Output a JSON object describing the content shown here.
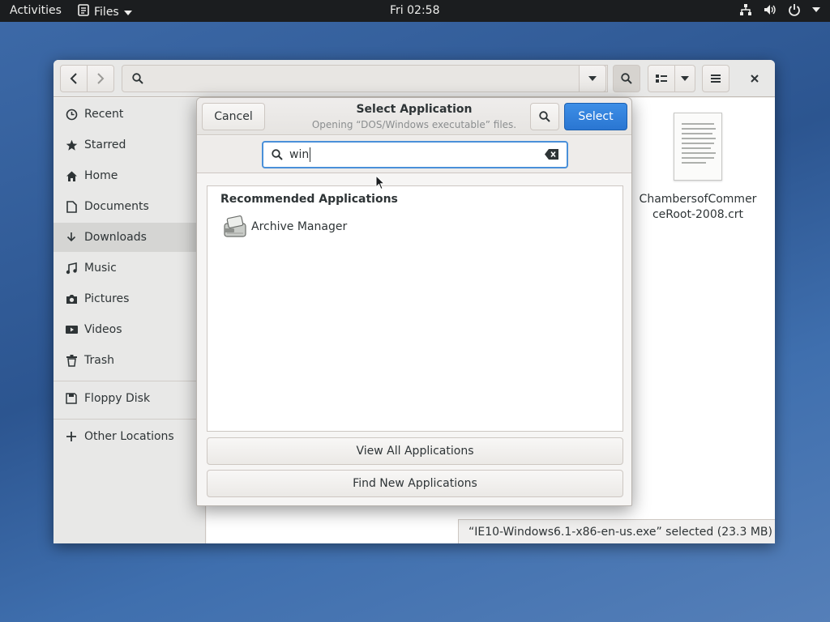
{
  "topbar": {
    "activities": "Activities",
    "app_name": "Files",
    "clock": "Fri 02:58"
  },
  "files_window": {
    "sidebar": {
      "items": [
        {
          "label": "Recent",
          "icon": "clock-icon"
        },
        {
          "label": "Starred",
          "icon": "star-icon"
        },
        {
          "label": "Home",
          "icon": "home-icon"
        },
        {
          "label": "Documents",
          "icon": "document-icon"
        },
        {
          "label": "Downloads",
          "icon": "download-icon",
          "active": true
        },
        {
          "label": "Music",
          "icon": "music-icon"
        },
        {
          "label": "Pictures",
          "icon": "camera-icon"
        },
        {
          "label": "Videos",
          "icon": "video-icon"
        },
        {
          "label": "Trash",
          "icon": "trash-icon"
        },
        {
          "label": "Floppy Disk",
          "icon": "floppy-icon"
        },
        {
          "label": "Other Locations",
          "icon": "plus-icon"
        }
      ]
    },
    "file": {
      "name_line1": "ChambersofCommer",
      "name_line2": "ceRoot-2008.crt"
    },
    "status": "“IE10-Windows6.1-x86-en-us.exe” selected  (23.3 MB)"
  },
  "dialog": {
    "cancel_label": "Cancel",
    "title": "Select Application",
    "subtitle": "Opening “DOS/Windows executable” files.",
    "select_label": "Select",
    "search_value": "win",
    "section_heading": "Recommended Applications",
    "apps": [
      {
        "label": "Archive Manager",
        "icon": "archive-manager-icon"
      }
    ],
    "view_all_label": "View All Applications",
    "find_new_label": "Find New Applications"
  },
  "colors": {
    "accent": "#2a76d2",
    "topbar": "#1b1d1f",
    "focus": "#4a90d9"
  }
}
